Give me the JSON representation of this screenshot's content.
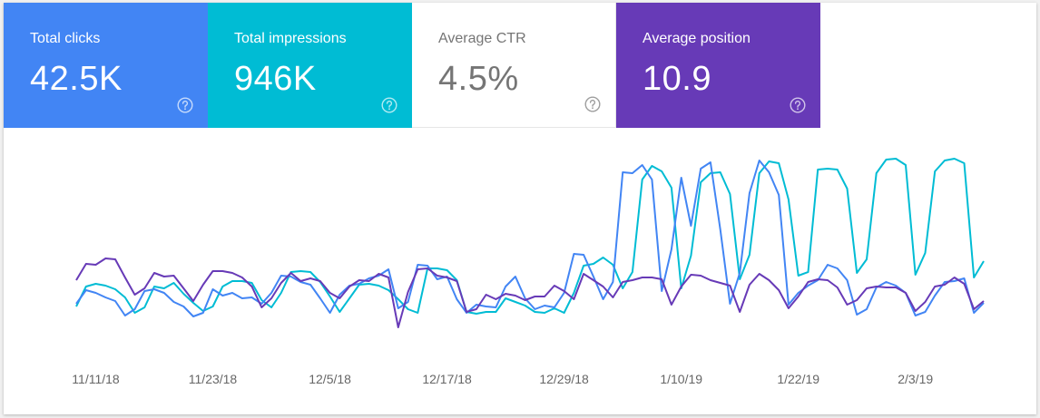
{
  "metrics": [
    {
      "label": "Total clicks",
      "value": "42.5K",
      "active": true,
      "bg": "#4285f4",
      "fg": "#ffffff",
      "icon": "help-circle-icon"
    },
    {
      "label": "Total impressions",
      "value": "946K",
      "active": true,
      "bg": "#00bcd4",
      "fg": "#ffffff",
      "icon": "help-circle-icon"
    },
    {
      "label": "Average CTR",
      "value": "4.5%",
      "active": false,
      "bg": "#ffffff",
      "fg": "#757575",
      "icon": "help-circle-icon"
    },
    {
      "label": "Average position",
      "value": "10.9",
      "active": true,
      "bg": "#673ab7",
      "fg": "#ffffff",
      "icon": "help-circle-icon"
    }
  ],
  "chart_data": {
    "type": "line",
    "x_start": "11/9/18",
    "x_end": "2/10/19",
    "x_ticks": [
      "11/11/18",
      "11/23/18",
      "12/5/18",
      "12/17/18",
      "12/29/18",
      "1/10/19",
      "1/22/19",
      "2/3/19"
    ],
    "grid": false,
    "legend": "none",
    "y_axis": "hidden",
    "series": [
      {
        "metric": "Total impressions",
        "color": "#00bcd4",
        "values": [
          0.23,
          0.45,
          0.48,
          0.46,
          0.42,
          0.33,
          0.16,
          0.22,
          0.45,
          0.43,
          0.49,
          0.37,
          0.27,
          0.18,
          0.23,
          0.45,
          0.51,
          0.51,
          0.49,
          0.3,
          0.22,
          0.38,
          0.61,
          0.62,
          0.61,
          0.5,
          0.34,
          0.17,
          0.32,
          0.47,
          0.48,
          0.46,
          0.41,
          0.31,
          0.2,
          0.16,
          0.65,
          0.65,
          0.63,
          0.52,
          0.17,
          0.15,
          0.17,
          0.17,
          0.32,
          0.28,
          0.24,
          0.17,
          0.16,
          0.21,
          0.16,
          0.38,
          0.68,
          0.7,
          0.77,
          0.69,
          0.43,
          0.61,
          1.63,
          1.78,
          1.72,
          1.54,
          0.43,
          0.79,
          1.6,
          1.7,
          1.71,
          1.47,
          0.53,
          0.8,
          1.7,
          1.83,
          1.81,
          1.41,
          0.57,
          0.61,
          1.74,
          1.75,
          1.74,
          1.53,
          0.6,
          0.75,
          1.7,
          1.85,
          1.86,
          1.79,
          0.58,
          0.82,
          1.72,
          1.84,
          1.86,
          1.81,
          0.55,
          0.73
        ]
      },
      {
        "metric": "Total clicks",
        "color": "#4285f4",
        "values": [
          0.26,
          0.41,
          0.38,
          0.33,
          0.29,
          0.13,
          0.2,
          0.4,
          0.42,
          0.38,
          0.28,
          0.23,
          0.12,
          0.16,
          0.42,
          0.35,
          0.38,
          0.32,
          0.33,
          0.26,
          0.38,
          0.57,
          0.56,
          0.5,
          0.47,
          0.32,
          0.16,
          0.36,
          0.46,
          0.48,
          0.54,
          0.57,
          0.64,
          0.21,
          0.28,
          0.69,
          0.68,
          0.53,
          0.56,
          0.31,
          0.16,
          0.25,
          0.23,
          0.22,
          0.45,
          0.56,
          0.32,
          0.2,
          0.24,
          0.22,
          0.38,
          0.81,
          0.8,
          0.56,
          0.31,
          0.5,
          1.71,
          1.7,
          1.79,
          1.63,
          0.4,
          0.86,
          1.65,
          1.12,
          1.75,
          1.82,
          1.08,
          0.26,
          0.6,
          1.48,
          1.84,
          1.71,
          1.46,
          0.25,
          0.38,
          0.46,
          0.52,
          0.69,
          0.65,
          0.52,
          0.14,
          0.2,
          0.44,
          0.5,
          0.46,
          0.38,
          0.13,
          0.17,
          0.35,
          0.5,
          0.51,
          0.54,
          0.16,
          0.27
        ]
      },
      {
        "metric": "Average position",
        "color": "#673ab7",
        "values": [
          0.52,
          0.7,
          0.69,
          0.76,
          0.75,
          0.55,
          0.36,
          0.43,
          0.6,
          0.56,
          0.57,
          0.43,
          0.29,
          0.47,
          0.62,
          0.62,
          0.6,
          0.55,
          0.45,
          0.22,
          0.32,
          0.49,
          0.6,
          0.51,
          0.54,
          0.51,
          0.38,
          0.32,
          0.45,
          0.52,
          0.51,
          0.59,
          0.55,
          0.0,
          0.39,
          0.64,
          0.65,
          0.57,
          0.55,
          0.51,
          0.17,
          0.2,
          0.36,
          0.31,
          0.37,
          0.35,
          0.3,
          0.34,
          0.34,
          0.46,
          0.4,
          0.31,
          0.59,
          0.52,
          0.45,
          0.33,
          0.5,
          0.52,
          0.55,
          0.55,
          0.53,
          0.25,
          0.45,
          0.58,
          0.57,
          0.52,
          0.49,
          0.46,
          0.17,
          0.47,
          0.59,
          0.52,
          0.41,
          0.21,
          0.34,
          0.5,
          0.53,
          0.52,
          0.44,
          0.25,
          0.3,
          0.43,
          0.45,
          0.44,
          0.44,
          0.38,
          0.18,
          0.28,
          0.45,
          0.47,
          0.55,
          0.48,
          0.2,
          0.29
        ]
      }
    ]
  }
}
